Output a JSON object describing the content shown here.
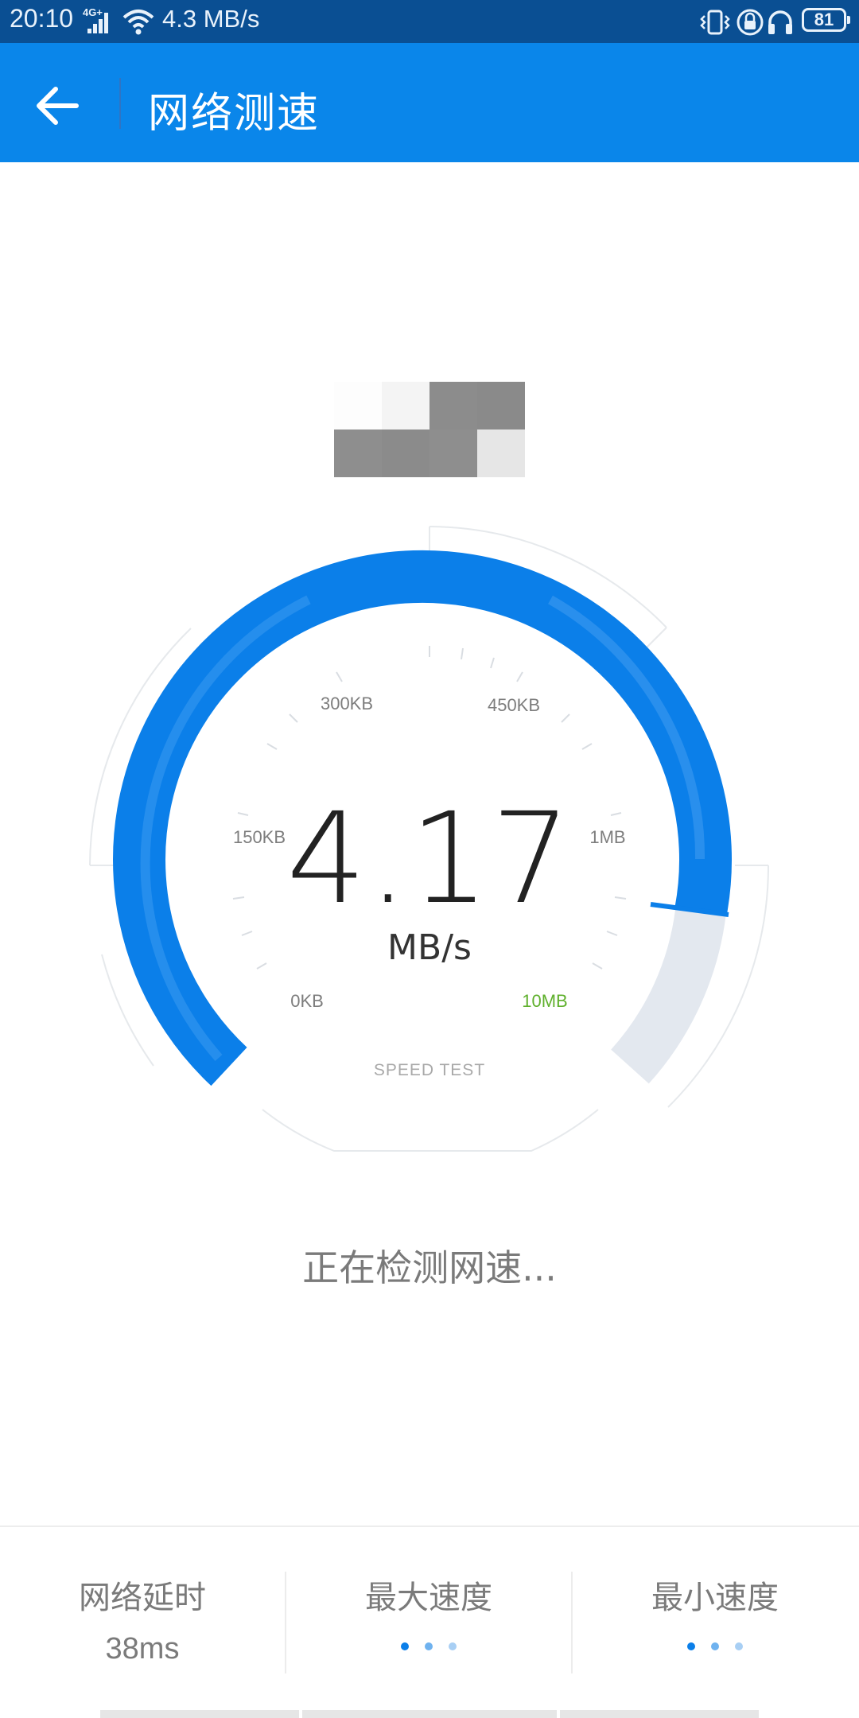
{
  "status_bar": {
    "time": "20:10",
    "network_type": "4G+",
    "speed": "4.3 MB/s",
    "battery": "81",
    "icons": [
      "signal-icon",
      "wifi-icon",
      "vibrate-icon",
      "rotation-lock-icon",
      "headphones-icon",
      "battery-icon"
    ]
  },
  "app_bar": {
    "title": "网络测速",
    "back_icon": "back-arrow-icon"
  },
  "gauge": {
    "value": "4.17",
    "unit": "MB/s",
    "progress_fraction": 0.74,
    "tick_labels": {
      "t0": "0KB",
      "t1": "150KB",
      "t2": "300KB",
      "t3": "450KB",
      "t4": "1MB",
      "t5": "10MB"
    },
    "caption": "SPEED TEST",
    "colors": {
      "arc": "#0b7fe9",
      "arc_light": "#56a8f0",
      "track": "#e3e8ef",
      "max_label": "#5fb02c"
    }
  },
  "status_text": "正在检测网速...",
  "stats": [
    {
      "label": "网络延时",
      "value": "38ms"
    },
    {
      "label": "最大速度",
      "value": ""
    },
    {
      "label": "最小速度",
      "value": ""
    }
  ],
  "colors": {
    "status_bar": "#0a4f93",
    "app_bar": "#0a86ea"
  }
}
